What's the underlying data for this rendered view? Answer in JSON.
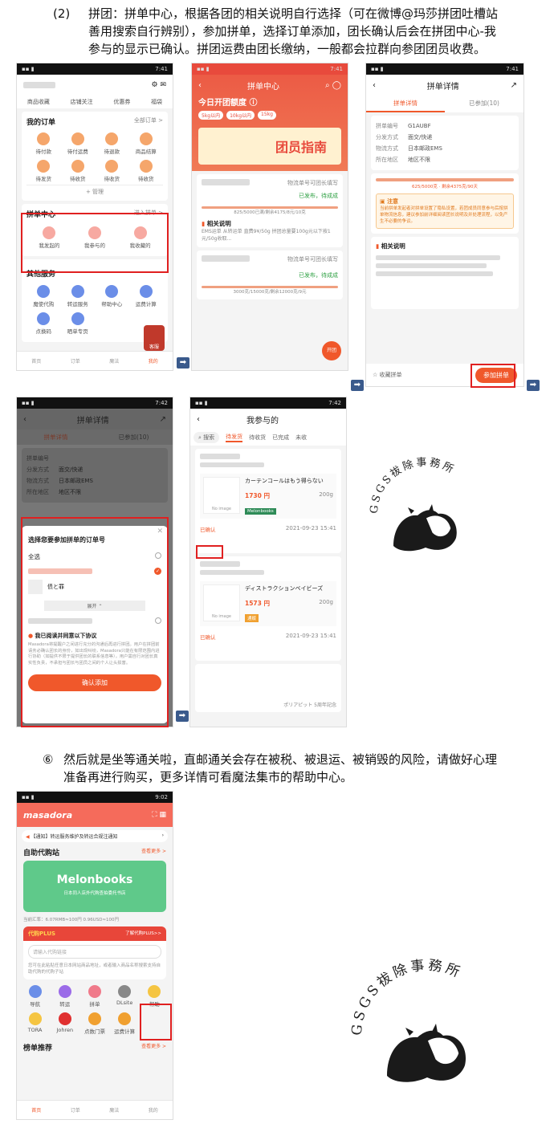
{
  "step2": {
    "number": "(2)",
    "line1": "拼团：拼单中心，根据各团的相关说明自行选择（可在微博@玛莎拼团吐槽站",
    "line2": "善用搜索自行辨别），参加拼单，选择订单添加，团长确认后会在拼团中心-我",
    "line3": "参与的显示已确认。拼团运费由团长缴纳，一般都会拉群向参团团员收费。"
  },
  "step6": {
    "number": "⑥",
    "line1": "然后就是坐等通关啦，直邮通关会存在被税、被退运、被销毁的风险，请做好心理",
    "line2": "准备再进行购买，更多详情可看魔法集市的帮助中心。"
  },
  "status": {
    "time1": "7:41",
    "time2": "7:41",
    "time3": "7:41",
    "time4": "7:42",
    "time5": "7:42",
    "time6": "9:02"
  },
  "shot1": {
    "top_tabs": [
      "商品收藏",
      "店铺关注",
      "优惠券",
      "福袋"
    ],
    "orders_title": "我的订单",
    "orders_all": "全部订单 >",
    "order_items": [
      "待付款",
      "待付运费",
      "待退款",
      "商品结算",
      "待发货",
      "待收货",
      "待收货",
      "待收货"
    ],
    "manage": "+ 管理",
    "group_title": "拼单中心",
    "group_enter": "进入拼单 >",
    "group_items": [
      "我发起的",
      "我参与的",
      "我收藏的"
    ],
    "other_title": "其他服务",
    "other_items": [
      "魔使代购",
      "转运服务",
      "帮助中心",
      "运费计算",
      "点换码",
      "晒单专页"
    ],
    "help_badge": "客服",
    "tabs": [
      "首页",
      "订单",
      "魔法",
      "我的"
    ]
  },
  "shot2": {
    "nav_title": "拼单中心",
    "banner_title": "今日开团额度 ⓘ",
    "chip1": "5kg以内",
    "chip2": "10kg以内",
    "chip3": "15kg",
    "guide": "团员指南",
    "item1_tag": "物流单号可团长填写",
    "item1_status": "已发布，待成成",
    "item1_progress": "825/5000已满/剩余4175/8元/10克",
    "desc_title": "相关说明",
    "desc_text": "EMS运单 从转运单 直费9¥/50g 拼团总量要100g元以下按1元/50g收取...",
    "item2_tag": "物流单号可团长填写",
    "item2_status": "已发布，待成成",
    "item2_progress": "3000克/15000克/剩余12000克/9元",
    "fab": "开团"
  },
  "shot3": {
    "nav_title": "拼单详情",
    "tab1": "拼单详情",
    "tab2": "已参加(10)",
    "rows": [
      [
        "拼单编号",
        "G1AUBF"
      ],
      [
        "分发方式",
        "面交/快递"
      ],
      [
        "物流方式",
        "日本邮政EMS"
      ],
      [
        "所在地区",
        "地区不限"
      ]
    ],
    "progress_label": "625/5000克 · 剩余4375克/90天",
    "notice_title": "注意",
    "notice_text": "当前拼单发起者对拼单设置了隐私设置，若团成员同意参与后按拼单物流信息，建议参加前详细阅读团长说明及并处理流程，以免产生不必要的争议。",
    "desc_title": "相关说明",
    "fav": "收藏拼单",
    "join": "参加拼单"
  },
  "shot4": {
    "nav_title": "拼单详情",
    "tab1": "拼单详情",
    "tab2": "已参加(10)",
    "rows": [
      [
        "拼单编号",
        ""
      ],
      [
        "分发方式",
        "面交/快递"
      ],
      [
        "物流方式",
        "日本邮政EMS"
      ],
      [
        "所在地区",
        "地区不限"
      ]
    ],
    "modal_title": "选择您要参加拼单的订单号",
    "select_all": "全选",
    "item_name": "债と罪",
    "collapse": "展开 ⌃",
    "agree": "我已阅读并同意以下协议",
    "agree_text": "Masadora将提醒户之间进行充分的沟通后再进行拼团。用户在拼团前请务必确认团长的身份，如出现纠纷，Masadora只能在有限范围内进行协助（如提供不限于提供团长的联系信息等），用户需自行对团长真实性负责，不承担与团长与团员之间的个人让头损害。",
    "confirm": "确认添加"
  },
  "shot5": {
    "nav_title": "我参与的",
    "search": "搜索",
    "tabs": [
      "待发货",
      "待收货",
      "已完成",
      "未收"
    ],
    "item1_title": "カーテンコールはもう得らない",
    "item1_price": "1730 円",
    "item1_weight": "200g",
    "item1_shop": "Melonbooks",
    "item1_status": "已确认",
    "item1_date": "2021-09-23 15:41",
    "item2_title": "ディストラクションベイビーズ",
    "item2_price": "1573 円",
    "item2_weight": "200g",
    "item2_shop": "通贩",
    "item2_status": "已确认",
    "item2_date": "2021-09-23 15:41",
    "no_image": "No image",
    "footer_text": "ポリアピット 5周年記念"
  },
  "shot6": {
    "brand": "masadora",
    "notice": "【通知】转运服务维护及转运合规注通知",
    "self_title": "自助代购站",
    "more": "查看更多 >",
    "melon": "Melonbooks",
    "melon_sub": "日本同人店外代购查拍委托书店",
    "rate": "当前汇率：6.07RMB≈100円 0.96USD≈100円",
    "plus": "代购PLUS",
    "plus_link": "了解代购PLUS>>",
    "input_placeholder": "请输入代购链接",
    "plus_desc": "您可在此粘贴任意日本网站商品地址，或者输入商品名称搜索支持自助代购的代购子站",
    "icons": [
      "导航",
      "转运",
      "拼单",
      "DLsite",
      "帮助",
      "TORA",
      "Johren",
      "点数门票",
      "运费计算"
    ],
    "rank_title": "榜单推荐",
    "rank_more": "查看更多 >",
    "tabs": [
      "首页",
      "订单",
      "魔法",
      "我的"
    ]
  },
  "stamp": {
    "name": "GSGS祓除事務所",
    "romaji": "gsgsexorcists"
  },
  "colors": {
    "accent": "#f0582b",
    "red_box": "#e02020",
    "arrow": "#3a5a8c"
  }
}
